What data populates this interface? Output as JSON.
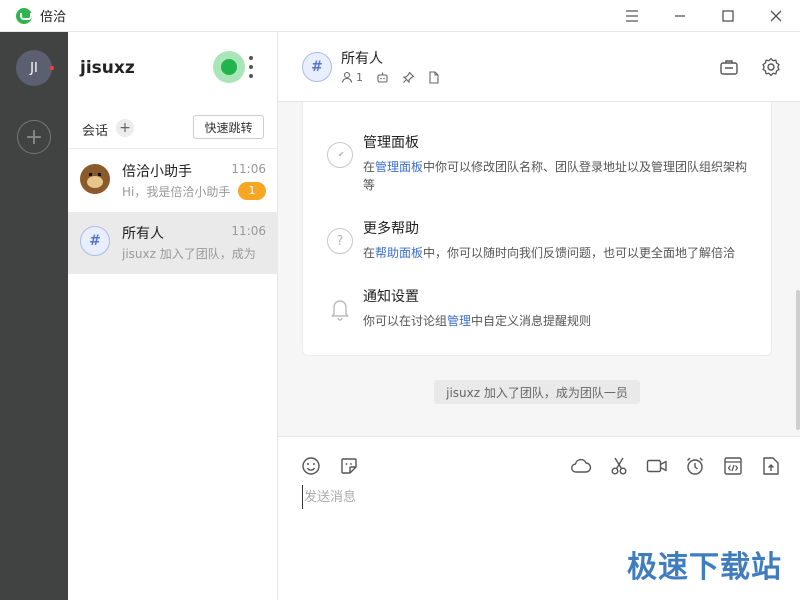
{
  "window": {
    "title": "倍洽",
    "controls": [
      "menu-icon",
      "minimize-icon",
      "maximize-icon",
      "close-icon"
    ]
  },
  "rail": {
    "avatar_initials": "JI",
    "add_icon": "plus-icon"
  },
  "sidebar": {
    "username": "jisuxz",
    "status_color": "#22b34d",
    "sessions_label": "会话",
    "quick_jump_label": "快速跳转",
    "chats": [
      {
        "name": "倍洽小助手",
        "time": "11:06",
        "preview": "Hi，我是倍洽小助手",
        "badge": "1",
        "avatar": "bear-avatar"
      },
      {
        "name": "所有人",
        "time": "11:06",
        "preview": "jisuxz 加入了团队，成为团队一员",
        "badge": "",
        "avatar": "hash-avatar"
      }
    ]
  },
  "channel": {
    "title": "所有人",
    "member_count": "1",
    "header_icons": [
      "user-icon",
      "robot-icon",
      "pin-icon",
      "file-icon"
    ],
    "right_icons": [
      "briefcase-icon",
      "gear-icon"
    ]
  },
  "intro_card": {
    "features": [
      {
        "icon": "dashboard-icon",
        "title": "管理面板",
        "desc_pre": "在",
        "desc_link": "管理面板",
        "desc_post": "中你可以修改团队名称、团队登录地址以及管理团队组织架构等"
      },
      {
        "icon": "help-icon",
        "title": "更多帮助",
        "desc_pre": "在",
        "desc_link": "帮助面板",
        "desc_post": "中，你可以随时向我们反馈问题，也可以更全面地了解倍洽"
      },
      {
        "icon": "bell-icon",
        "title": "通知设置",
        "desc_pre": "你可以在讨论组",
        "desc_link": "管理",
        "desc_post": "中自定义消息提醒规则"
      }
    ]
  },
  "system_message": "jisuxz 加入了团队，成为团队一员",
  "composer": {
    "placeholder": "发送消息",
    "left_tools": [
      "emoji-icon",
      "sticker-icon"
    ],
    "right_tools": [
      "cloud-icon",
      "scissors-icon",
      "video-icon",
      "alarm-icon",
      "code-icon",
      "upload-icon"
    ]
  },
  "watermark": "极速下载站"
}
